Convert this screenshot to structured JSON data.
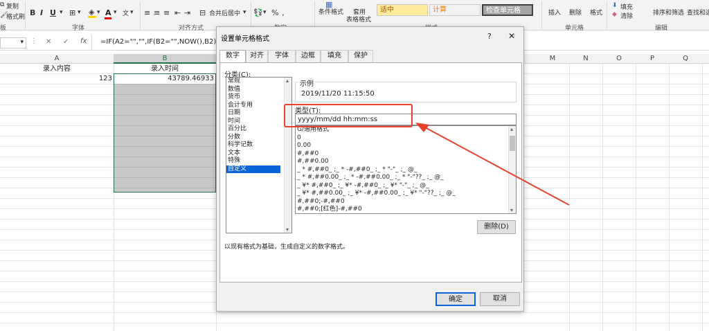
{
  "ribbon": {
    "copy": "复制",
    "format_painter": "格式刷",
    "group_font": "字体",
    "group_align": "对齐方式",
    "merge_center": "合并后居中",
    "group_number": "数字",
    "cond_format": "条件格式",
    "table_format_top": "套用",
    "table_format_bottom": "表格格式",
    "style_normal": "适中",
    "style_calc": "计算",
    "style_check": "检查单元格",
    "group_styles": "样式",
    "insert": "插入",
    "delete": "删除",
    "format": "格式",
    "group_cells": "单元格",
    "fill": "填充",
    "clear": "清除",
    "sort_filter": "排序和筛选",
    "find_select": "查找和选",
    "group_edit": "编辑",
    "partial_left": "板"
  },
  "formula_bar": {
    "name_box_arrow": "▾",
    "cancel": "✕",
    "enter": "✓",
    "fx": "fx",
    "formula": "=IF(A2=\"\",\"\",IF(B2=\"\",NOW(),B2))"
  },
  "columns": [
    "A",
    "B",
    "M",
    "N",
    "O",
    "P",
    "Q"
  ],
  "cells": {
    "a1": "录入内容",
    "b1": "录入时间",
    "a2": "123",
    "b2": "43789.46933"
  },
  "dialog": {
    "title": "设置单元格格式",
    "help": "?",
    "close": "✕",
    "tabs": [
      "数字",
      "对齐",
      "字体",
      "边框",
      "填充",
      "保护"
    ],
    "category_label": "分类(C):",
    "categories": [
      "常规",
      "数值",
      "货币",
      "会计专用",
      "日期",
      "时间",
      "百分比",
      "分数",
      "科学记数",
      "文本",
      "特殊",
      "自定义"
    ],
    "selected_category": "自定义",
    "sample_label": "示例",
    "sample_value": "2019/11/20 11:15:50",
    "type_label": "类型(T):",
    "type_value": "yyyy/mm/dd hh:mm:ss",
    "formats": [
      "G/通用格式",
      "0",
      "0.00",
      "#,##0",
      "#,##0.00",
      "_ * #,##0_ ;_ * -#,##0_ ;_ * \"-\"_ ;_ @_",
      "_ * #,##0.00_ ;_ * -#,##0.00_ ;_ * \"-\"??_ ;_ @_",
      "_ ¥* #,##0_ ;_ ¥* -#,##0_ ;_ ¥* \"-\"_ ;_ @_",
      "_ ¥* #,##0.00_ ;_ ¥* -#,##0.00_ ;_ ¥* \"-\"??_ ;_ @_",
      "#,##0;-#,##0",
      "#,##0;[红色]-#,##0"
    ],
    "delete_button": "删除(D)",
    "description": "以现有格式为基础，生成自定义的数字格式。",
    "ok": "确定",
    "cancel": "取消"
  },
  "colors": {
    "annotation": "#e8402f",
    "selection": "#0a64d8",
    "cell_selected_fill": "#c8c8c8",
    "cell_border": "#217346"
  }
}
